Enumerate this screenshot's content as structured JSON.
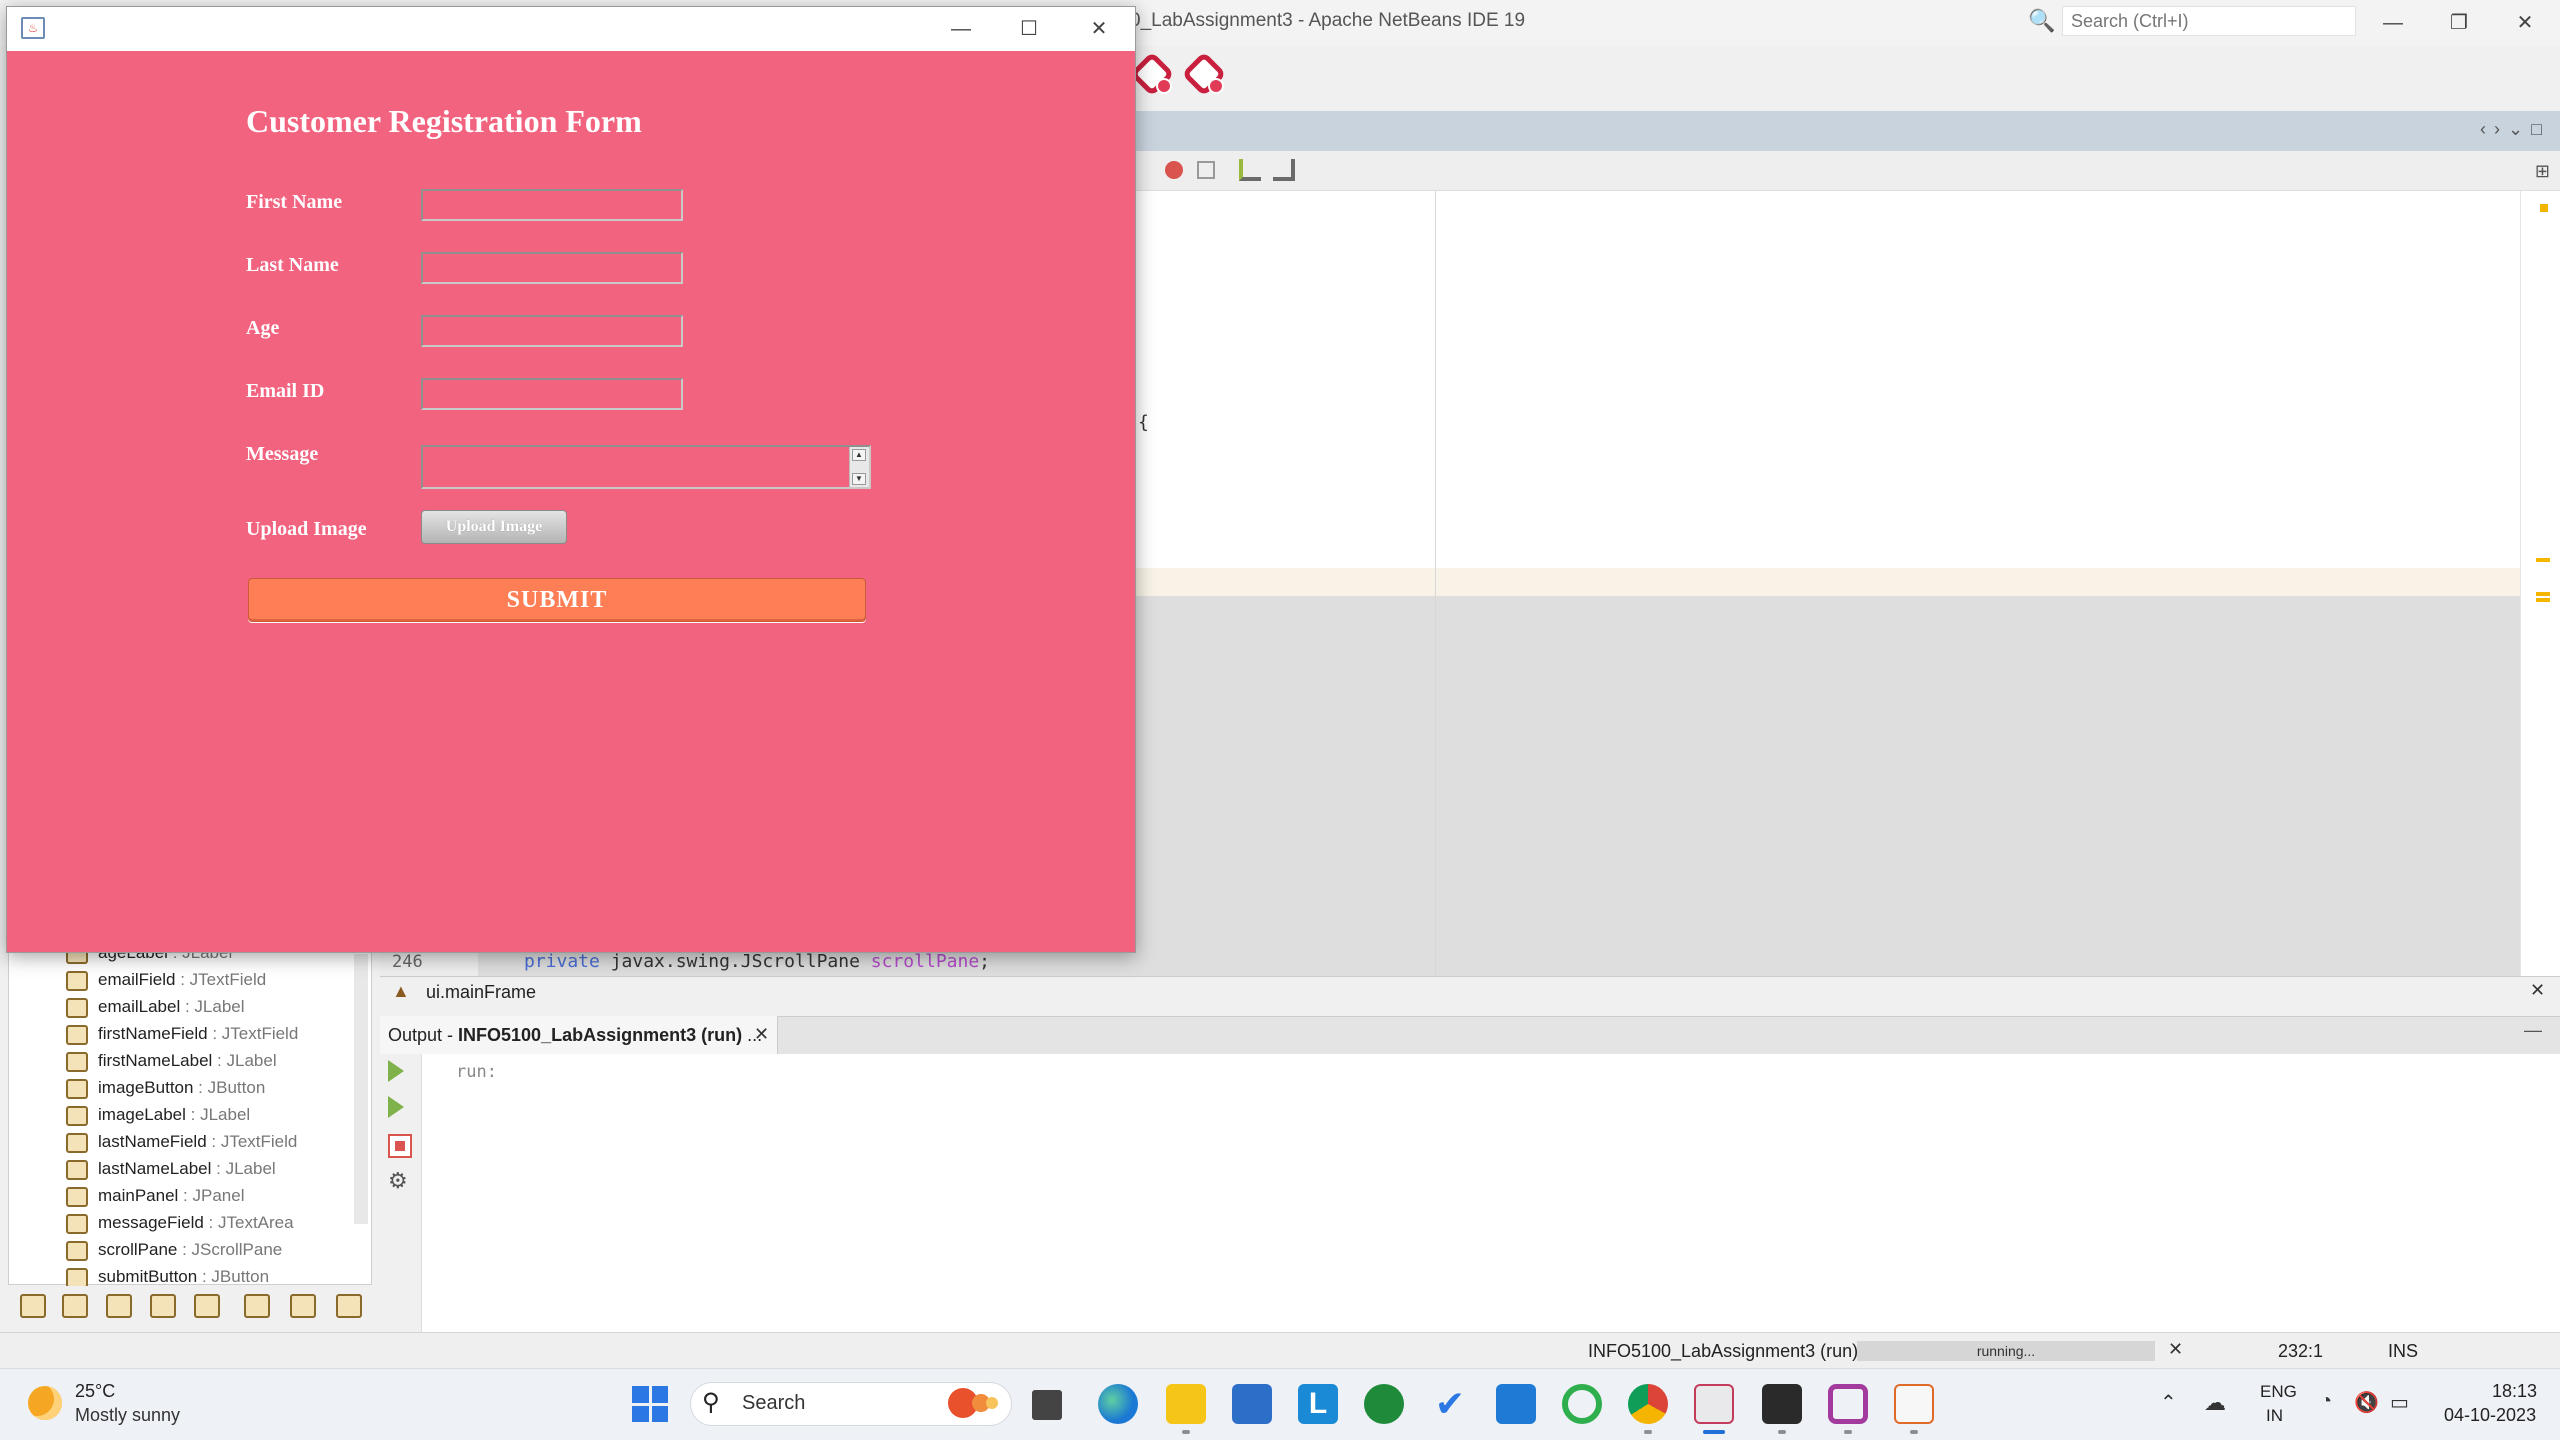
{
  "netbeans": {
    "title": "0_LabAssignment3 - Apache NetBeans IDE 19",
    "search_placeholder": "Search (Ctrl+I)",
    "window_controls": {
      "minimize": "—",
      "restore": "❐",
      "close": "✕"
    },
    "editor": {
      "brace": "{",
      "line_number": "246",
      "code": {
        "keyword": "private",
        "type": " javax.swing.JScrollPane ",
        "var": "scrollPane",
        "end": ";"
      }
    },
    "breadcrumb": "ui.mainFrame",
    "navigator": {
      "items": [
        {
          "name": "ageLabel",
          "type": " : JLabel"
        },
        {
          "name": "emailField",
          "type": " : JTextField"
        },
        {
          "name": "emailLabel",
          "type": " : JLabel"
        },
        {
          "name": "firstNameField",
          "type": " : JTextField"
        },
        {
          "name": "firstNameLabel",
          "type": " : JLabel"
        },
        {
          "name": "imageButton",
          "type": " : JButton"
        },
        {
          "name": "imageLabel",
          "type": " : JLabel"
        },
        {
          "name": "lastNameField",
          "type": " : JTextField"
        },
        {
          "name": "lastNameLabel",
          "type": " : JLabel"
        },
        {
          "name": "mainPanel",
          "type": " : JPanel"
        },
        {
          "name": "messageField",
          "type": " : JTextArea"
        },
        {
          "name": "scrollPane",
          "type": " : JScrollPane"
        },
        {
          "name": "submitButton",
          "type": " : JButton"
        }
      ]
    },
    "output": {
      "tab_prefix": "Output - ",
      "tab_name": "INFO5100_LabAssignment3 (run)",
      "tab_suffix": " ...",
      "text": "run:"
    },
    "status": {
      "project": "INFO5100_LabAssignment3 (run)",
      "progress_label": "running...",
      "progress": 1.0,
      "position": "232:1",
      "mode": "INS"
    }
  },
  "form_window": {
    "title": "Customer Registration Form",
    "labels": {
      "first_name": "First Name",
      "last_name": "Last Name",
      "age": "Age",
      "email": "Email ID",
      "message": "Message",
      "upload": "Upload Image"
    },
    "values": {
      "first_name": "",
      "last_name": "",
      "age": "",
      "email": "",
      "message": ""
    },
    "upload_button": "Upload Image",
    "submit_button": "SUBMIT",
    "colors": {
      "background": "#f26380",
      "submit": "#fe7e55",
      "text": "#ffffff"
    }
  },
  "taskbar": {
    "weather": {
      "temp": "25°C",
      "desc": "Mostly sunny"
    },
    "search": "Search",
    "tray": {
      "lang1": "ENG",
      "lang2": "IN",
      "time": "18:13",
      "date": "04-10-2023"
    }
  }
}
